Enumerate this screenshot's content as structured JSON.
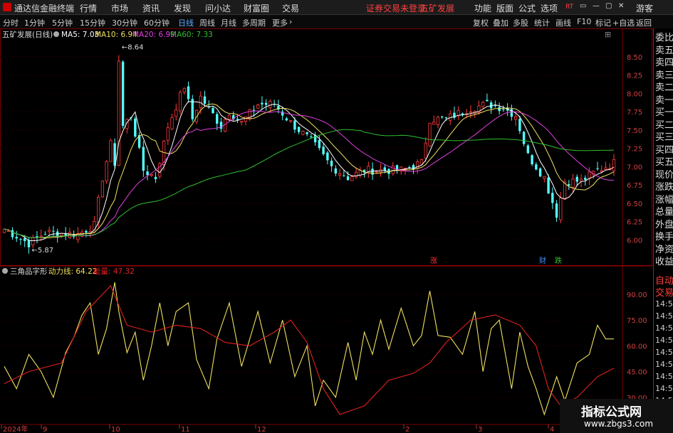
{
  "app": {
    "title": "通达信金融终端",
    "menu": [
      "行情",
      "市场",
      "资讯",
      "发现",
      "问小达",
      "财富圈",
      "交易"
    ],
    "notice": "证券交易未登录",
    "stock_name_top": "五矿发展",
    "right_menu": [
      "功能",
      "版面",
      "公式",
      "选项"
    ],
    "rt_icon": "RT",
    "guest": "游客",
    "window_controls": [
      "▭",
      "—",
      "▢",
      "✕"
    ]
  },
  "toolbar": {
    "periods": [
      "分时",
      "1分钟",
      "5分钟",
      "15分钟",
      "30分钟",
      "60分钟",
      "日线",
      "周线",
      "月线",
      "多周期",
      "更多"
    ],
    "active_period": "日线",
    "more_arrow": "›",
    "right_buttons": [
      "复权",
      "叠加",
      "多股",
      "统计",
      "画线",
      "F10",
      "标记",
      "+自选",
      "返回"
    ]
  },
  "main_panel": {
    "title": "五矿发展(日线)",
    "ma_legend": [
      {
        "label": "MA5: 7.03",
        "color": "#ffffff"
      },
      {
        "label": "MA10: 6.94",
        "color": "#f0e060"
      },
      {
        "label": "MA20: 6.99",
        "color": "#e040e0"
      },
      {
        "label": "MA60: 7.33",
        "color": "#30c030"
      }
    ],
    "high_label": "8.64",
    "low_label": "5.87",
    "markers": [
      {
        "text": "涨",
        "color": "#ff3030"
      },
      {
        "text": "财",
        "color": "#4090ff"
      },
      {
        "text": "跌",
        "color": "#30c030"
      }
    ]
  },
  "sub_panel": {
    "title": "三角品字形",
    "legend": [
      {
        "label": "动力线: 64.22",
        "color": "#f0e060"
      },
      {
        "label": "能量: 47.32",
        "color": "#e02020"
      }
    ]
  },
  "x_axis": {
    "labels": [
      "2024年",
      "9",
      "10",
      "11",
      "12",
      "2",
      "3",
      "4"
    ]
  },
  "right_panel": {
    "items": [
      "委比",
      "卖五",
      "卖四",
      "卖三",
      "卖二",
      "卖一",
      "买一",
      "买二",
      "买三",
      "买四",
      "买五",
      "现价",
      "涨跌",
      "涨幅",
      "总量",
      "外盘",
      "换手",
      "净资",
      "收益"
    ],
    "tabs": [
      "自动",
      "交易"
    ],
    "times": [
      "14:56",
      "14:56",
      "14:56",
      "14:56",
      "14:56",
      "14:56",
      "14:56",
      "14:56",
      "14:56",
      "14:56"
    ]
  },
  "watermark": {
    "text": "指标公式网",
    "url": "www.zbgs3.com"
  },
  "chart_data": [
    {
      "type": "candlestick",
      "title": "五矿发展(日线)",
      "ylim": [
        5.8,
        8.75
      ],
      "yticks": [
        6.0,
        6.25,
        6.5,
        6.75,
        7.0,
        7.25,
        7.5,
        7.75,
        8.0,
        8.25,
        8.5
      ],
      "n": 150,
      "price_path": [
        [
          0,
          6.15
        ],
        [
          6,
          5.95
        ],
        [
          10,
          6.1
        ],
        [
          18,
          6.08
        ],
        [
          22,
          6.2
        ],
        [
          24,
          6.85
        ],
        [
          26,
          7.3
        ],
        [
          27,
          7.05
        ],
        [
          28,
          8.45
        ],
        [
          29,
          7.55
        ],
        [
          31,
          7.7
        ],
        [
          34,
          6.95
        ],
        [
          37,
          6.85
        ],
        [
          40,
          7.55
        ],
        [
          44,
          8.1
        ],
        [
          46,
          7.65
        ],
        [
          48,
          7.95
        ],
        [
          53,
          7.55
        ],
        [
          55,
          7.75
        ],
        [
          58,
          7.6
        ],
        [
          62,
          7.85
        ],
        [
          66,
          7.85
        ],
        [
          70,
          7.6
        ],
        [
          75,
          7.35
        ],
        [
          80,
          7.0
        ],
        [
          84,
          6.85
        ],
        [
          88,
          6.95
        ],
        [
          93,
          6.95
        ],
        [
          97,
          6.95
        ],
        [
          102,
          7.05
        ],
        [
          104,
          7.65
        ],
        [
          108,
          7.65
        ],
        [
          114,
          7.8
        ],
        [
          118,
          7.85
        ],
        [
          122,
          7.8
        ],
        [
          125,
          7.7
        ],
        [
          128,
          7.15
        ],
        [
          132,
          6.85
        ],
        [
          135,
          6.35
        ],
        [
          137,
          6.8
        ],
        [
          141,
          6.8
        ],
        [
          145,
          6.95
        ],
        [
          149,
          7.05
        ]
      ],
      "series": [
        {
          "name": "MA5",
          "color": "#ffffff"
        },
        {
          "name": "MA10",
          "color": "#f0e060"
        },
        {
          "name": "MA20",
          "color": "#e040e0"
        },
        {
          "name": "MA60",
          "color": "#30c030"
        }
      ],
      "ma_legend_values": {
        "MA5": 7.03,
        "MA10": 6.94,
        "MA20": 6.99,
        "MA60": 7.33
      },
      "annotations": [
        {
          "text": "8.64",
          "x": 28,
          "y": 8.64
        },
        {
          "text": "5.87",
          "x": 6,
          "y": 5.87
        }
      ]
    },
    {
      "type": "line",
      "title": "三角品字形",
      "ylim": [
        15,
        102
      ],
      "yticks": [
        30.0,
        45.0,
        60.0,
        75.0,
        90.0
      ],
      "series": [
        {
          "name": "动力线",
          "color": "#f0e060",
          "path": [
            [
              0,
              48
            ],
            [
              3,
              35
            ],
            [
              6,
              55
            ],
            [
              9,
              45
            ],
            [
              12,
              30
            ],
            [
              15,
              56
            ],
            [
              17,
              65
            ],
            [
              19,
              78
            ],
            [
              21,
              85
            ],
            [
              23,
              55
            ],
            [
              25,
              70
            ],
            [
              27,
              97
            ],
            [
              28,
              80
            ],
            [
              30,
              56
            ],
            [
              32,
              68
            ],
            [
              34,
              40
            ],
            [
              36,
              60
            ],
            [
              38,
              85
            ],
            [
              40,
              60
            ],
            [
              42,
              80
            ],
            [
              45,
              85
            ],
            [
              47,
              52
            ],
            [
              50,
              35
            ],
            [
              52,
              64
            ],
            [
              55,
              85
            ],
            [
              58,
              48
            ],
            [
              62,
              80
            ],
            [
              65,
              50
            ],
            [
              68,
              75
            ],
            [
              71,
              42
            ],
            [
              74,
              60
            ],
            [
              76,
              25
            ],
            [
              78,
              40
            ],
            [
              81,
              30
            ],
            [
              84,
              62
            ],
            [
              86,
              40
            ],
            [
              88,
              68
            ],
            [
              90,
              55
            ],
            [
              92,
              75
            ],
            [
              94,
              58
            ],
            [
              97,
              82
            ],
            [
              100,
              60
            ],
            [
              102,
              66
            ],
            [
              104,
              92
            ],
            [
              106,
              66
            ],
            [
              109,
              65
            ],
            [
              112,
              55
            ],
            [
              115,
              80
            ],
            [
              117,
              45
            ],
            [
              119,
              70
            ],
            [
              121,
              75
            ],
            [
              124,
              35
            ],
            [
              126,
              68
            ],
            [
              128,
              48
            ],
            [
              130,
              35
            ],
            [
              132,
              20
            ],
            [
              135,
              42
            ],
            [
              137,
              28
            ],
            [
              140,
              50
            ],
            [
              143,
              55
            ],
            [
              145,
              72
            ],
            [
              147,
              64
            ],
            [
              149,
              64
            ]
          ]
        },
        {
          "name": "能量",
          "color": "#e02020",
          "path": [
            [
              0,
              38
            ],
            [
              6,
              45
            ],
            [
              14,
              50
            ],
            [
              20,
              80
            ],
            [
              26,
              95
            ],
            [
              30,
              72
            ],
            [
              36,
              68
            ],
            [
              42,
              72
            ],
            [
              48,
              70
            ],
            [
              54,
              62
            ],
            [
              60,
              60
            ],
            [
              66,
              68
            ],
            [
              70,
              75
            ],
            [
              74,
              62
            ],
            [
              78,
              35
            ],
            [
              82,
              20
            ],
            [
              88,
              25
            ],
            [
              94,
              40
            ],
            [
              100,
              44
            ],
            [
              104,
              50
            ],
            [
              108,
              62
            ],
            [
              114,
              75
            ],
            [
              120,
              78
            ],
            [
              126,
              72
            ],
            [
              130,
              60
            ],
            [
              133,
              35
            ],
            [
              136,
              25
            ],
            [
              140,
              30
            ],
            [
              145,
              42
            ],
            [
              149,
              47
            ]
          ]
        }
      ],
      "legend_values": {
        "动力线": 64.22,
        "能量": 47.32
      }
    }
  ]
}
